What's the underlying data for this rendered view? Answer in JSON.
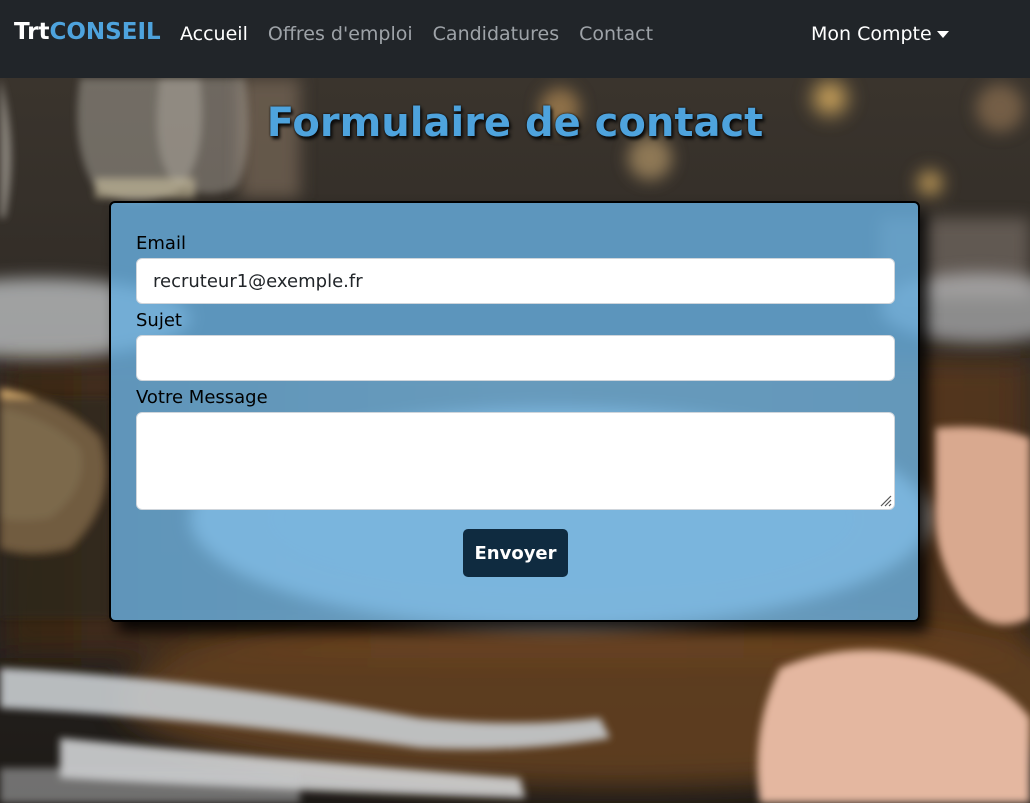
{
  "navbar": {
    "brand_part1": "Trt",
    "brand_part2": "CONSEIL",
    "links": [
      {
        "label": "Accueil",
        "active": true
      },
      {
        "label": "Offres d'emploi",
        "active": false
      },
      {
        "label": "Candidatures",
        "active": false
      },
      {
        "label": "Contact",
        "active": false
      }
    ],
    "account_label": "Mon Compte",
    "account_icon": "caret-down-icon"
  },
  "page": {
    "title": "Formulaire de contact"
  },
  "form": {
    "email_label": "Email",
    "email_value": "recruteur1@exemple.fr",
    "subject_label": "Sujet",
    "subject_value": "",
    "message_label": "Votre Message",
    "message_value": "",
    "submit_label": "Envoyer"
  },
  "colors": {
    "navbar_bg": "#212529",
    "accent": "#4ea3dd",
    "card_bg": "#68b0e2",
    "button_bg": "#0f2b40"
  }
}
